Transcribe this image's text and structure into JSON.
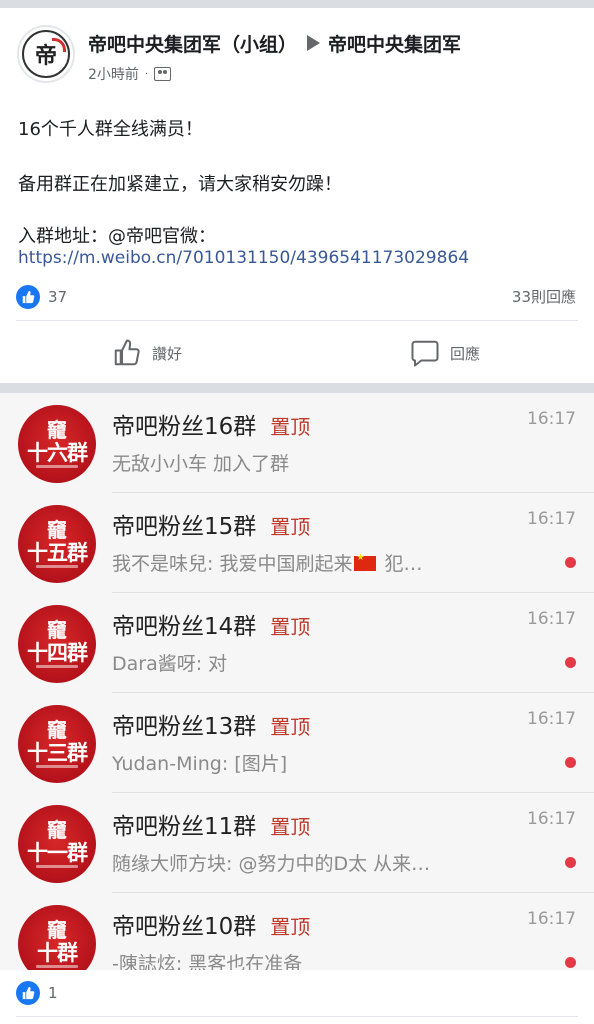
{
  "post": {
    "author": "帝吧中央集团军（小组）",
    "target": "帝吧中央集团军",
    "time": "2小時前",
    "dot": "·",
    "avatar_text": "帝",
    "lines": [
      "16个千人群全线满员！",
      "备用群正在加紧建立，请大家稍安勿躁！",
      "入群地址：@帝吧官微："
    ],
    "link": "https://m.weibo.cn/7010131150/4396541173029864",
    "like_count": "37",
    "comment_count": "33則回應",
    "like_action": "讚好",
    "comment_action": "回應"
  },
  "chat_list": {
    "avatar_logo": "竉",
    "pin_label": "置顶",
    "items": [
      {
        "name": "帝吧粉丝16群",
        "avatar_num": "十六群",
        "time": "16:17",
        "message": "无敌小小车 加入了群",
        "unread": false
      },
      {
        "name": "帝吧粉丝15群",
        "avatar_num": "十五群",
        "time": "16:17",
        "message_before_flag": "我不是味兒: 我爱中国刷起来",
        "message_after_flag": " 犯…",
        "unread": true
      },
      {
        "name": "帝吧粉丝14群",
        "avatar_num": "十四群",
        "time": "16:17",
        "message": "Dara酱呀: 对",
        "unread": true
      },
      {
        "name": "帝吧粉丝13群",
        "avatar_num": "十三群",
        "time": "16:17",
        "message": "Yudan-Ming: [图片]",
        "unread": true
      },
      {
        "name": "帝吧粉丝11群",
        "avatar_num": "十一群",
        "time": "16:17",
        "message": "随缘大师方块: @努力中的D太 从来…",
        "unread": true
      },
      {
        "name": "帝吧粉丝10群",
        "avatar_num": "十群",
        "time": "16:17",
        "message": "-陳誌炫: 黑客也在准备",
        "unread": true
      }
    ]
  },
  "comment_reaction": {
    "like_count": "1"
  },
  "colors": {
    "facebook_blue": "#1877f2",
    "link": "#385898",
    "pin_red": "#c0392b",
    "avatar_red": "#b5121b"
  }
}
